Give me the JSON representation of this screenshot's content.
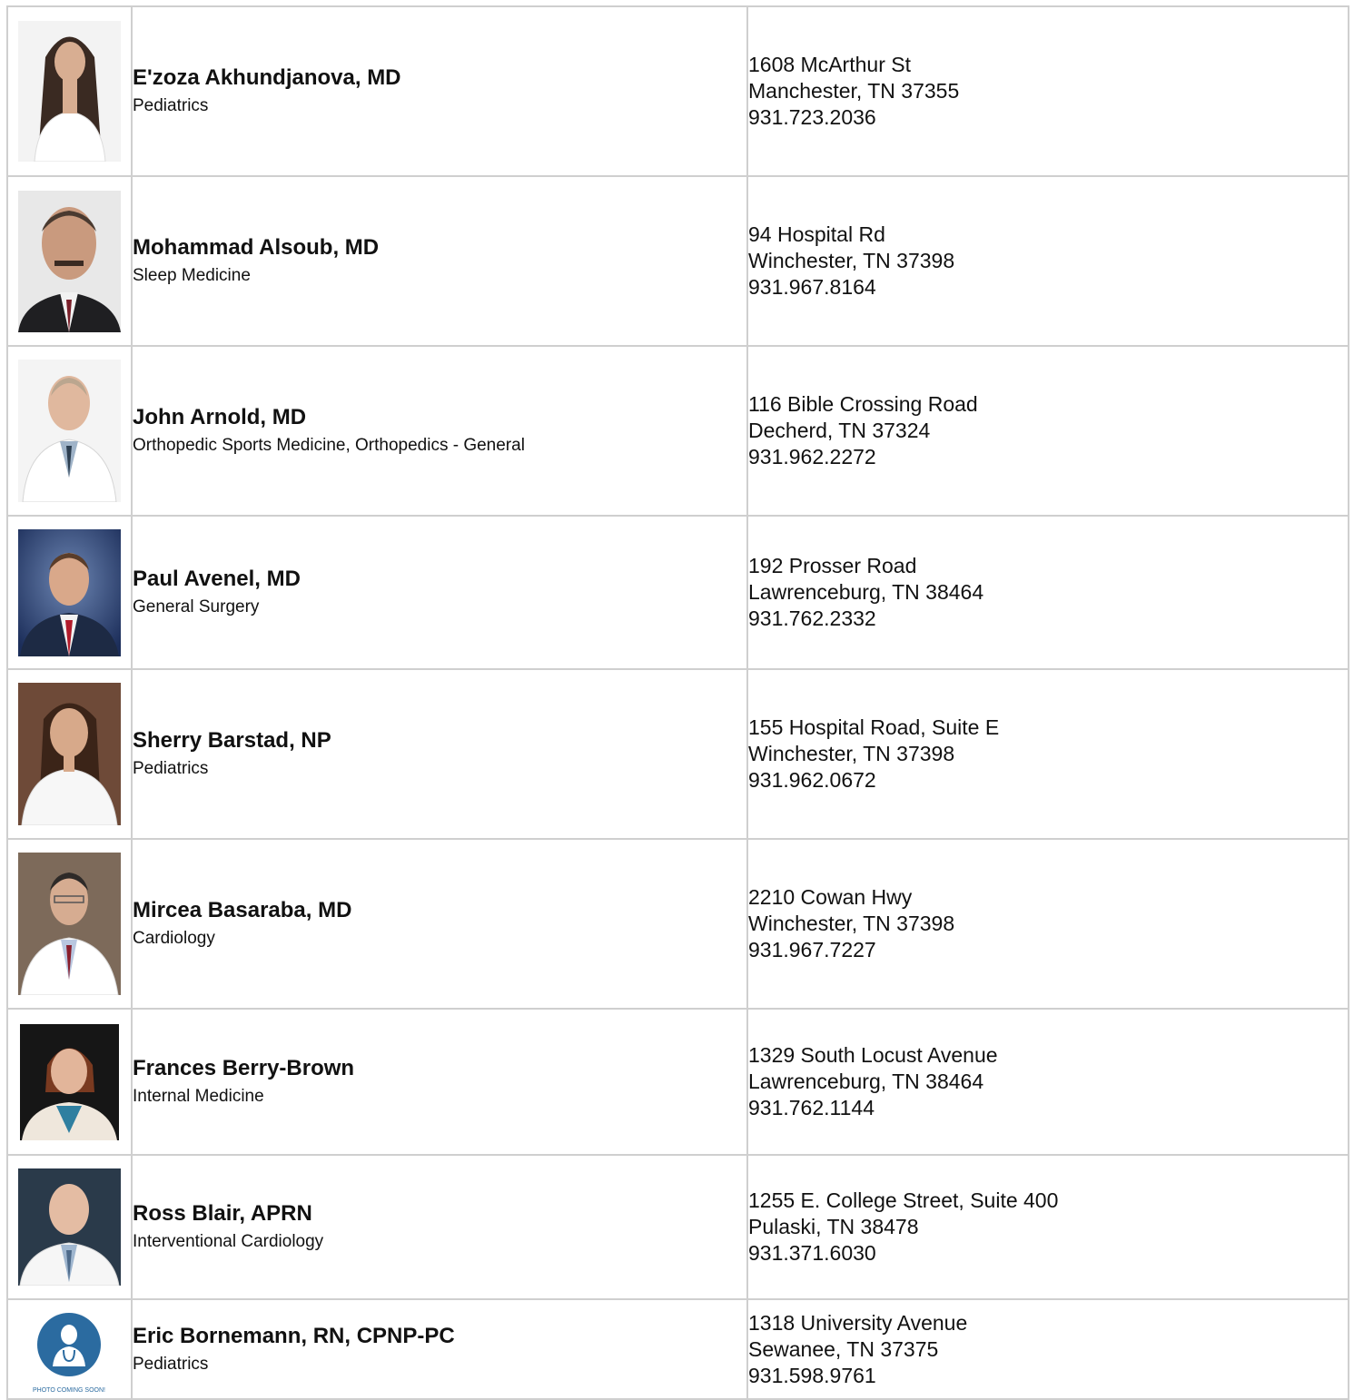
{
  "providers": [
    {
      "name": "E'zoza Akhundjanova, MD",
      "specialty": "Pediatrics",
      "street": "1608 McArthur St",
      "city": "Manchester, TN 37355",
      "phone": "931.723.2036",
      "photo": "female-long-dark-hair"
    },
    {
      "name": "Mohammad Alsoub, MD",
      "specialty": "Sleep Medicine",
      "street": "94 Hospital Rd",
      "city": "Winchester, TN 37398",
      "phone": "931.967.8164",
      "photo": "male-mustache-suit"
    },
    {
      "name": "John Arnold, MD",
      "specialty": "Orthopedic Sports Medicine, Orthopedics - General",
      "street": "116 Bible Crossing Road",
      "city": "Decherd, TN 37324",
      "phone": "931.962.2272",
      "photo": "male-white-coat"
    },
    {
      "name": "Paul Avenel, MD",
      "specialty": "General Surgery",
      "street": "192 Prosser Road",
      "city": "Lawrenceburg, TN 38464",
      "phone": "931.762.2332",
      "photo": "male-suit-blue-backdrop"
    },
    {
      "name": "Sherry Barstad, NP",
      "specialty": "Pediatrics",
      "street": "155 Hospital Road, Suite E",
      "city": "Winchester, TN 37398",
      "phone": "931.962.0672",
      "photo": "female-white-coat"
    },
    {
      "name": "Mircea Basaraba, MD",
      "specialty": "Cardiology",
      "street": "2210 Cowan Hwy",
      "city": "Winchester, TN 37398",
      "phone": "931.967.7227",
      "photo": "male-glasses-white-coat"
    },
    {
      "name": "Frances Berry-Brown",
      "specialty": "Internal Medicine",
      "street": "1329 South Locust Avenue",
      "city": "Lawrenceburg, TN 38464",
      "phone": "931.762.1144",
      "photo": "female-short-red-hair"
    },
    {
      "name": "Ross Blair, APRN",
      "specialty": "Interventional Cardiology",
      "street": "1255 E. College Street, Suite 400",
      "city": "Pulaski, TN 38478",
      "phone": "931.371.6030",
      "photo": "male-bald-white-coat"
    },
    {
      "name": "Eric Bornemann, RN, CPNP-PC",
      "specialty": "Pediatrics",
      "street": "1318 University Avenue",
      "city": "Sewanee, TN 37375",
      "phone": "931.598.9761",
      "photo": "photo-coming-soon",
      "photo_caption": "PHOTO COMING SOON!"
    }
  ]
}
